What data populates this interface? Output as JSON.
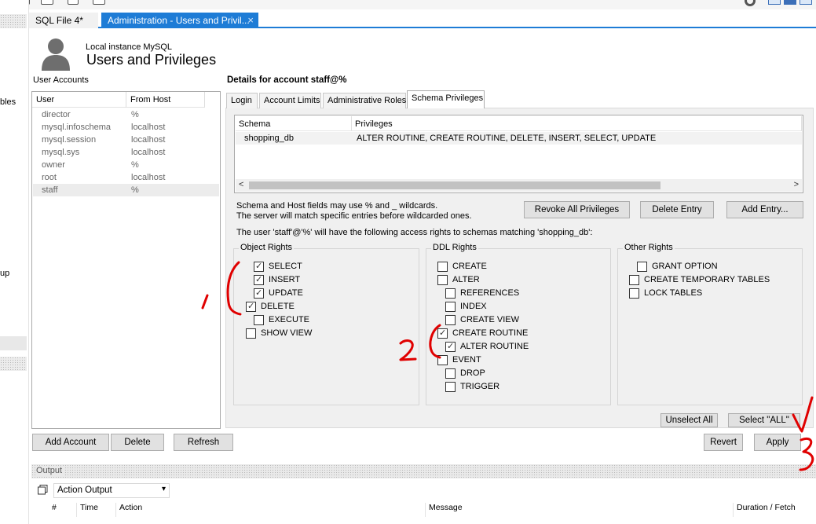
{
  "left_strip": {
    "items": [
      "bles",
      "up"
    ]
  },
  "tabs": [
    {
      "label": "SQL File 4*"
    },
    {
      "label": "Administration - Users and Privil...",
      "close": "×"
    }
  ],
  "header": {
    "instance": "Local instance MySQL",
    "title": "Users and Privileges"
  },
  "user_accounts": {
    "label": "User Accounts",
    "columns": [
      "User",
      "From Host"
    ],
    "rows": [
      {
        "user": "director",
        "host": "%"
      },
      {
        "user": "mysql.infoschema",
        "host": "localhost"
      },
      {
        "user": "mysql.session",
        "host": "localhost"
      },
      {
        "user": "mysql.sys",
        "host": "localhost"
      },
      {
        "user": "owner",
        "host": "%"
      },
      {
        "user": "root",
        "host": "localhost"
      },
      {
        "user": "staff",
        "host": "%"
      }
    ],
    "selected_index": 6,
    "buttons": {
      "add": "Add Account",
      "delete": "Delete",
      "refresh": "Refresh"
    }
  },
  "details": {
    "title": "Details for account staff@%",
    "tabs": [
      "Login",
      "Account Limits",
      "Administrative Roles",
      "Schema Privileges"
    ],
    "active_tab": "Schema Privileges",
    "schema_table": {
      "columns": [
        "Schema",
        "Privileges"
      ],
      "rows": [
        {
          "schema": "shopping_db",
          "privileges": "ALTER ROUTINE, CREATE ROUTINE, DELETE, INSERT, SELECT, UPDATE"
        }
      ],
      "scroll_left": "<",
      "scroll_right": ">"
    },
    "hint_line1": "Schema and Host fields may use % and _ wildcards.",
    "hint_line2": "The server will match specific entries before wildcarded ones.",
    "access_text": "The user 'staff'@'%' will have the following access rights to schemas matching 'shopping_db':",
    "buttons": {
      "revoke": "Revoke All Privileges",
      "delete_entry": "Delete Entry",
      "add_entry": "Add Entry...",
      "unselect_all": "Unselect All",
      "select_all": "Select \"ALL\"",
      "revert": "Revert",
      "apply": "Apply"
    },
    "object_rights": {
      "title": "Object Rights",
      "items": [
        {
          "label": "SELECT",
          "checked": true
        },
        {
          "label": "INSERT",
          "checked": true
        },
        {
          "label": "UPDATE",
          "checked": true
        },
        {
          "label": "DELETE",
          "checked": true
        },
        {
          "label": "EXECUTE",
          "checked": false
        },
        {
          "label": "SHOW VIEW",
          "checked": false
        }
      ]
    },
    "ddl_rights": {
      "title": "DDL Rights",
      "items": [
        {
          "label": "CREATE",
          "checked": false
        },
        {
          "label": "ALTER",
          "checked": false
        },
        {
          "label": "REFERENCES",
          "checked": false
        },
        {
          "label": "INDEX",
          "checked": false
        },
        {
          "label": "CREATE VIEW",
          "checked": false
        },
        {
          "label": "CREATE ROUTINE",
          "checked": true
        },
        {
          "label": "ALTER ROUTINE",
          "checked": true
        },
        {
          "label": "EVENT",
          "checked": false
        },
        {
          "label": "DROP",
          "checked": false
        },
        {
          "label": "TRIGGER",
          "checked": false
        }
      ]
    },
    "other_rights": {
      "title": "Other Rights",
      "items": [
        {
          "label": "GRANT OPTION",
          "checked": false
        },
        {
          "label": "CREATE TEMPORARY TABLES",
          "checked": false
        },
        {
          "label": "LOCK TABLES",
          "checked": false
        }
      ]
    }
  },
  "output": {
    "label": "Output",
    "selector": "Action Output",
    "columns": [
      "#",
      "Time",
      "Action",
      "Message",
      "Duration / Fetch"
    ]
  },
  "annotation_color": "#e00000"
}
